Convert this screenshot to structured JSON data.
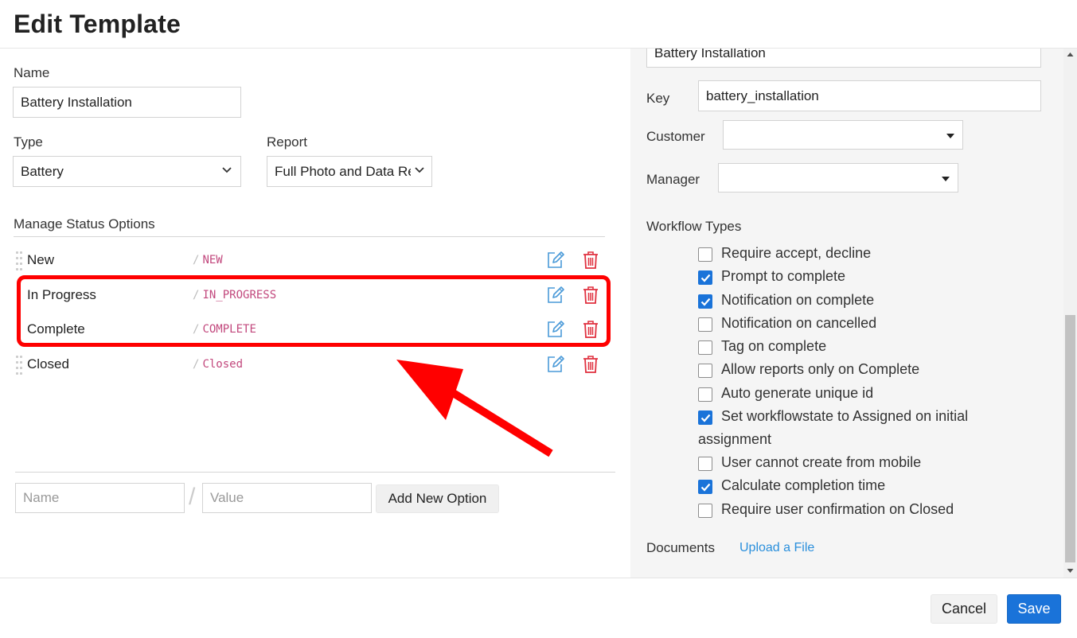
{
  "header": {
    "title": "Edit Template"
  },
  "form": {
    "name_label": "Name",
    "name_value": "Battery Installation",
    "type_label": "Type",
    "type_value": "Battery",
    "report_label": "Report",
    "report_value": "Full Photo and Data Rep",
    "manage_status_label": "Manage Status Options"
  },
  "statuses": [
    {
      "name": "New",
      "key": "NEW"
    },
    {
      "name": "In Progress",
      "key": "IN_PROGRESS"
    },
    {
      "name": "Complete",
      "key": "COMPLETE"
    },
    {
      "name": "Closed",
      "key": "Closed"
    }
  ],
  "key_separator": "/",
  "add_option": {
    "name_placeholder": "Name",
    "value_placeholder": "Value",
    "separator": "/",
    "button_label": "Add New Option"
  },
  "right_panel": {
    "display_name_value": "Battery Installation",
    "key_label": "Key",
    "key_value": "battery_installation",
    "customer_label": "Customer",
    "customer_value": "",
    "manager_label": "Manager",
    "manager_value": "",
    "workflow_label": "Workflow Types",
    "workflow_options": [
      {
        "label": "Require accept, decline",
        "checked": false
      },
      {
        "label": "Prompt to complete",
        "checked": true
      },
      {
        "label": "Notification on complete",
        "checked": true
      },
      {
        "label": "Notification on cancelled",
        "checked": false
      },
      {
        "label": "Tag on complete",
        "checked": false
      },
      {
        "label": "Allow reports only on Complete",
        "checked": false
      },
      {
        "label": "Auto generate unique id",
        "checked": false
      },
      {
        "label": "Set workflowstate to Assigned on initial",
        "label_cont": "assignment",
        "checked": true
      },
      {
        "label": "User cannot create from mobile",
        "checked": false
      },
      {
        "label": "Calculate completion time",
        "checked": true
      },
      {
        "label": "Require user confirmation on Closed",
        "checked": false
      }
    ],
    "documents_label": "Documents",
    "upload_link": "Upload a File"
  },
  "footer": {
    "cancel_label": "Cancel",
    "save_label": "Save"
  },
  "colors": {
    "accent": "#1a73d9",
    "annotation": "#ff0000",
    "status_key": "#c2487d",
    "delete": "#e0303f",
    "edit": "#4a9ad8"
  }
}
